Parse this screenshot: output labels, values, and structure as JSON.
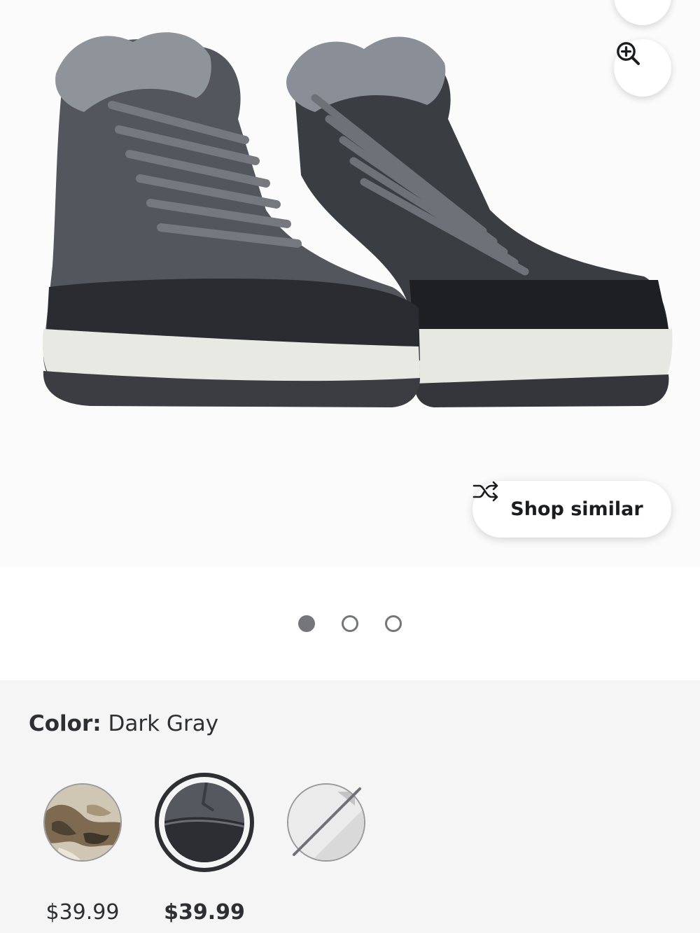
{
  "gallery": {
    "image_alt": "Dark gray fur-lined lace-up sneaker boots",
    "favorite_icon": "heart-icon",
    "zoom_icon": "zoom-in-icon",
    "shop_similar": {
      "icon": "shuffle-icon",
      "label": "Shop similar"
    },
    "pagination": {
      "count": 3,
      "active_index": 0
    }
  },
  "options": {
    "color_label": "Color:",
    "color_value": "Dark Gray",
    "swatches": [
      {
        "name": "Camo",
        "price": "$39.99",
        "selected": false,
        "available": true
      },
      {
        "name": "Dark Gray",
        "price": "$39.99",
        "selected": true,
        "available": true
      },
      {
        "name": "Gray",
        "price": "",
        "selected": false,
        "available": false
      }
    ]
  },
  "colors": {
    "dot_active": "#74767c",
    "options_background": "#f5f5f5",
    "selected_ring": "#2e2f32"
  }
}
